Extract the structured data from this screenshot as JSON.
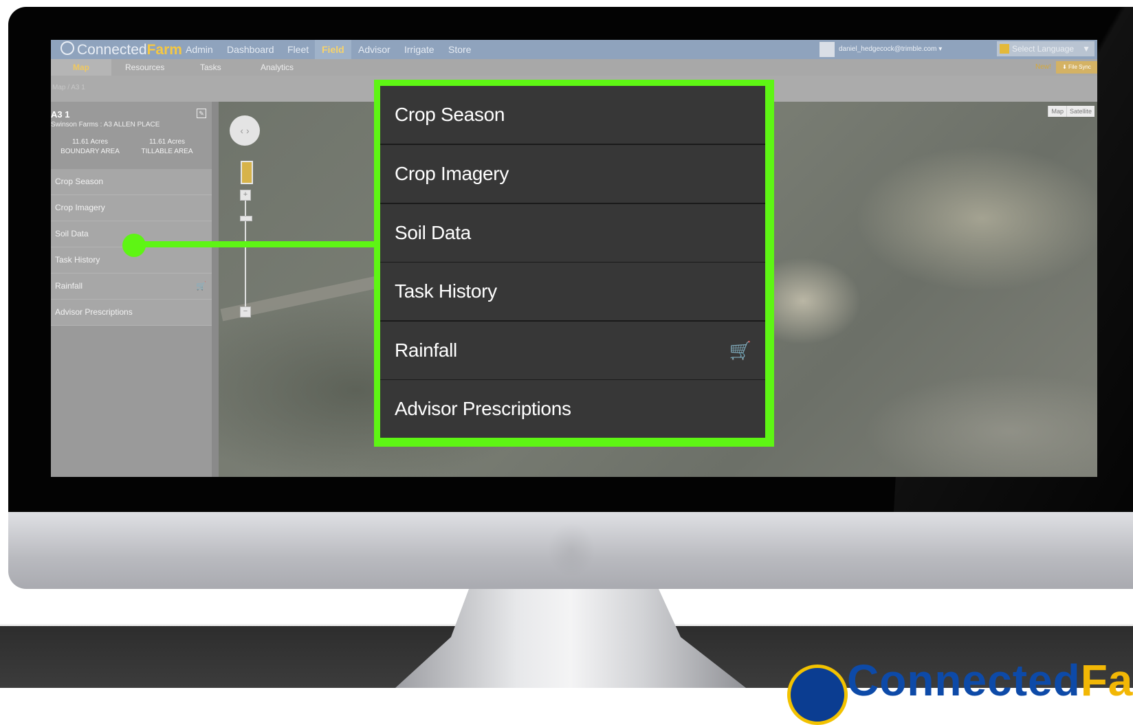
{
  "app": {
    "logo_connected": "Connected",
    "logo_farm": "Farm",
    "nav": [
      "Admin",
      "Dashboard",
      "Fleet",
      "Field",
      "Advisor",
      "Irrigate",
      "Store"
    ],
    "active_nav": "Field",
    "user_email": "daniel_hedgecock@trimble.com ▾",
    "language_select": "Select Language",
    "language_arrow": "▼"
  },
  "subnav": {
    "items": [
      "Map",
      "Resources",
      "Tasks",
      "Analytics"
    ],
    "active": "Map",
    "new_label": "New!",
    "file_sync": "⬇ File Sync"
  },
  "breadcrumb": "Map / A3 1",
  "field": {
    "title": "A3 1",
    "subtitle": "Swinson Farms : A3 ALLEN PLACE",
    "boundary_value": "11.61 Acres",
    "boundary_label": "BOUNDARY AREA",
    "tillable_value": "11.61 Acres",
    "tillable_label": "TILLABLE AREA"
  },
  "menu": [
    {
      "label": "Crop Season"
    },
    {
      "label": "Crop Imagery"
    },
    {
      "label": "Soil Data"
    },
    {
      "label": "Task History"
    },
    {
      "label": "Rainfall",
      "icon": "shopping-cart-icon"
    },
    {
      "label": "Advisor Prescriptions"
    }
  ],
  "map": {
    "type_map": "Map",
    "type_satellite": "Satellite",
    "zoom_in": "+",
    "zoom_out": "−"
  },
  "callout": {
    "items": [
      "Crop Season",
      "Crop Imagery",
      "Soil Data",
      "Task History",
      "Rainfall",
      "Advisor Prescriptions"
    ],
    "highlight_color": "#5ef514"
  },
  "brand_badge": {
    "part1": "Connected",
    "part2": "Fa"
  }
}
